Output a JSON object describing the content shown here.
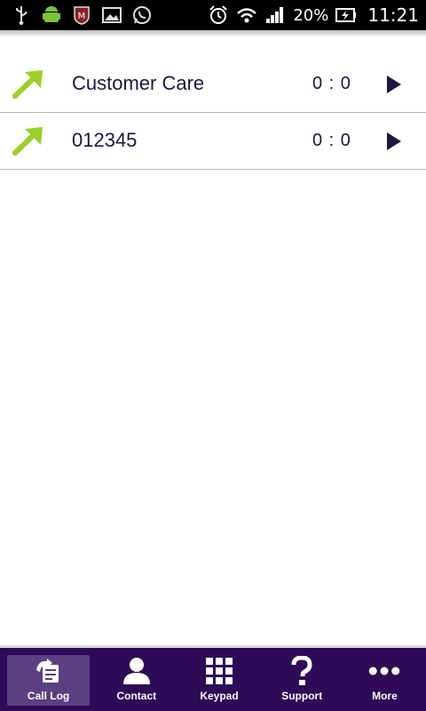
{
  "status_bar": {
    "left_icons": [
      "usb-icon",
      "android-debug-icon",
      "shield-app-icon",
      "image-notification-icon",
      "whatsapp-icon"
    ],
    "right_icons": [
      "alarm-icon",
      "wifi-icon",
      "signal-icon"
    ],
    "battery_percent": "20%",
    "time": "11:21"
  },
  "call_log": {
    "items": [
      {
        "name": "Customer Care",
        "duration": "0 : 0",
        "icon": "outgoing-call-arrow-icon"
      },
      {
        "name": "012345",
        "duration": "0 : 0",
        "icon": "outgoing-call-arrow-icon"
      }
    ]
  },
  "bottom_nav": {
    "items": [
      {
        "label": "Call Log",
        "icon": "call-log-icon",
        "active": true
      },
      {
        "label": "Contact",
        "icon": "contact-icon",
        "active": false
      },
      {
        "label": "Keypad",
        "icon": "keypad-icon",
        "active": false
      },
      {
        "label": "Support",
        "icon": "support-question-icon",
        "active": false
      },
      {
        "label": "More",
        "icon": "more-dots-icon",
        "active": false
      }
    ]
  },
  "colors": {
    "nav_background": "#2e0a57",
    "nav_active": "#5b3f82",
    "arrow_green": "#9bd02b",
    "text_dark": "#1b1740"
  }
}
